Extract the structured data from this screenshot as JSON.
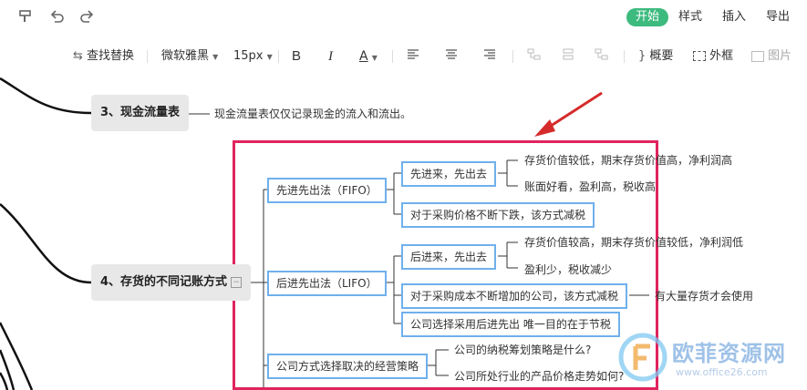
{
  "toolbar_top": {
    "tabs": {
      "start": "开始",
      "style": "样式",
      "insert": "插入",
      "export": "导出"
    }
  },
  "toolbar": {
    "find_replace": "查找替换",
    "font": "微软雅黑",
    "font_size": "15px",
    "bold": "B",
    "italic": "I",
    "font_color": "A",
    "summary": "概要",
    "border": "外框",
    "image": "图片"
  },
  "mindmap": {
    "topic3": {
      "number": "3",
      "label": "、现金流量表",
      "note": "现金流量表仅仅记录现金的流入和流出。"
    },
    "topic4": {
      "number": "4",
      "label": "、存货的不同记账方式"
    },
    "fifo": {
      "label": "先进先出法（FIFO）",
      "sub1": "先进来，先出去",
      "sub1_a": "存货价值较低，期末存货价值高，净利润高",
      "sub1_b": "账面好看，盈利高，税收高",
      "sub2": "对于采购价格不断下跌，该方式减税"
    },
    "lifo": {
      "label": "后进先出法（LIFO）",
      "sub1": "后进来，先出去",
      "sub1_a": "存货价值较高，期末存货价值较低，净利润低",
      "sub1_b": "盈利少，税收减少",
      "sub2": "对于采购成本不断增加的公司，该方式减税",
      "sub2_note": "有大量存货才会使用",
      "sub3": "公司选择采用后进先出 唯一目的在于节税"
    },
    "strategy": {
      "label": "公司方式选择取决的经营策略",
      "q1": "公司的纳税筹划策略是什么?",
      "q2": "公司所处行业的产品价格走势如何?"
    }
  },
  "watermark": {
    "text": "欧菲资源网",
    "url": "www.office26.com"
  },
  "colors": {
    "accent": "#3dba7e",
    "highlight": "#e0245e",
    "node_border": "#6fb0ec",
    "arrow": "#d62b2b"
  }
}
